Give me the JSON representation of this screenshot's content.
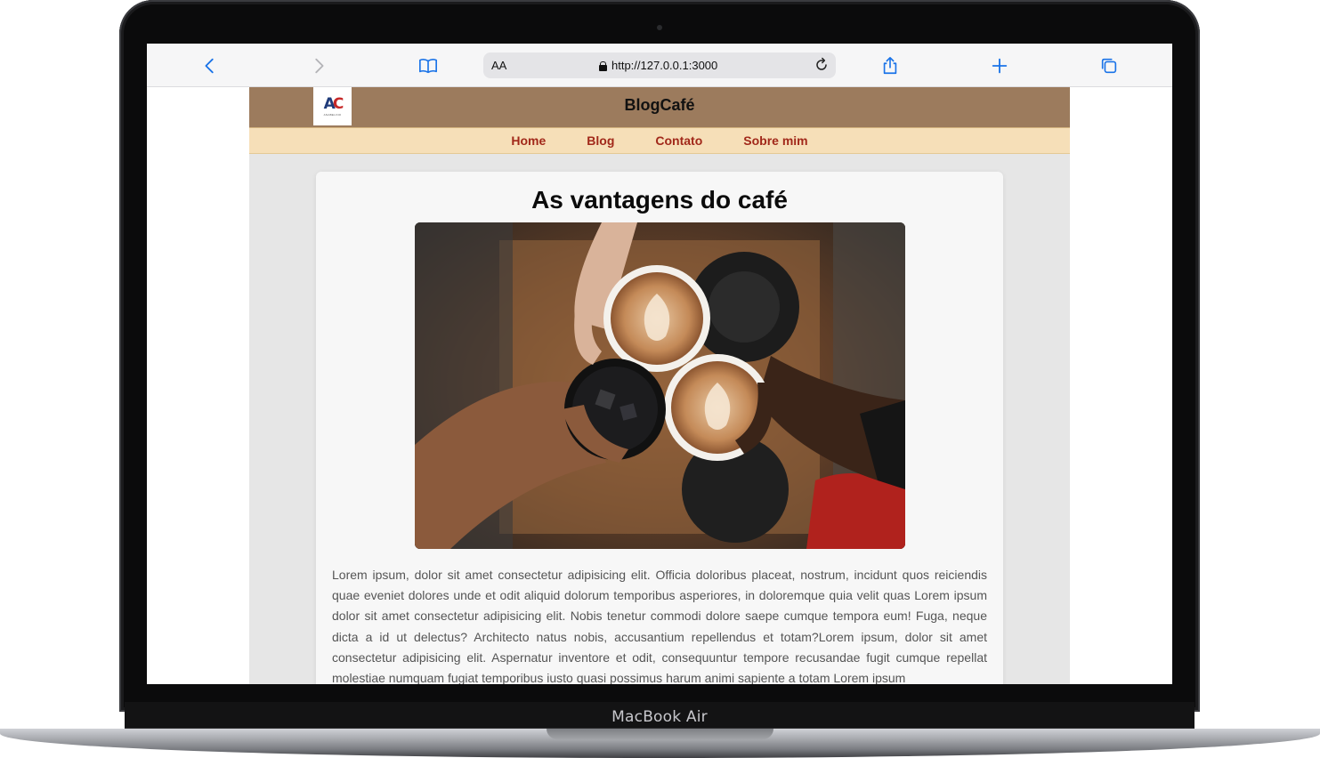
{
  "browser": {
    "address_aa": "AA",
    "url": "http://127.0.0.1:3000"
  },
  "device": {
    "label": "MacBook Air"
  },
  "site": {
    "logo_text": "AC",
    "logo_subtext": "ANABELINO",
    "title": "BlogCafé",
    "nav": [
      {
        "label": "Home"
      },
      {
        "label": "Blog"
      },
      {
        "label": "Contato"
      },
      {
        "label": "Sobre mim"
      }
    ]
  },
  "post": {
    "title": "As vantagens do café",
    "image_subject": "coffee-cups-toast-photo",
    "body": "Lorem ipsum, dolor sit amet consectetur adipisicing elit. Officia doloribus placeat, nostrum, incidunt quos reiciendis quae eveniet dolores unde et odit aliquid dolorum temporibus asperiores, in doloremque quia velit quas Lorem ipsum dolor sit amet consectetur adipisicing elit. Nobis tenetur commodi dolore saepe cumque tempora eum! Fuga, neque dicta a id ut delectus? Architecto natus nobis, accusantium repellendus et totam?Lorem ipsum, dolor sit amet consectetur adipisicing elit. Aspernatur inventore et odit, consequuntur tempore recusandae fugit cumque repellat molestiae numquam fugiat temporibus iusto quasi possimus harum animi sapiente a totam Lorem ipsum"
  },
  "colors": {
    "header": "#9c7b5d",
    "nav_bg": "#f6dfb8",
    "nav_link": "#a1281a",
    "accent_blue": "#1a73e8"
  }
}
